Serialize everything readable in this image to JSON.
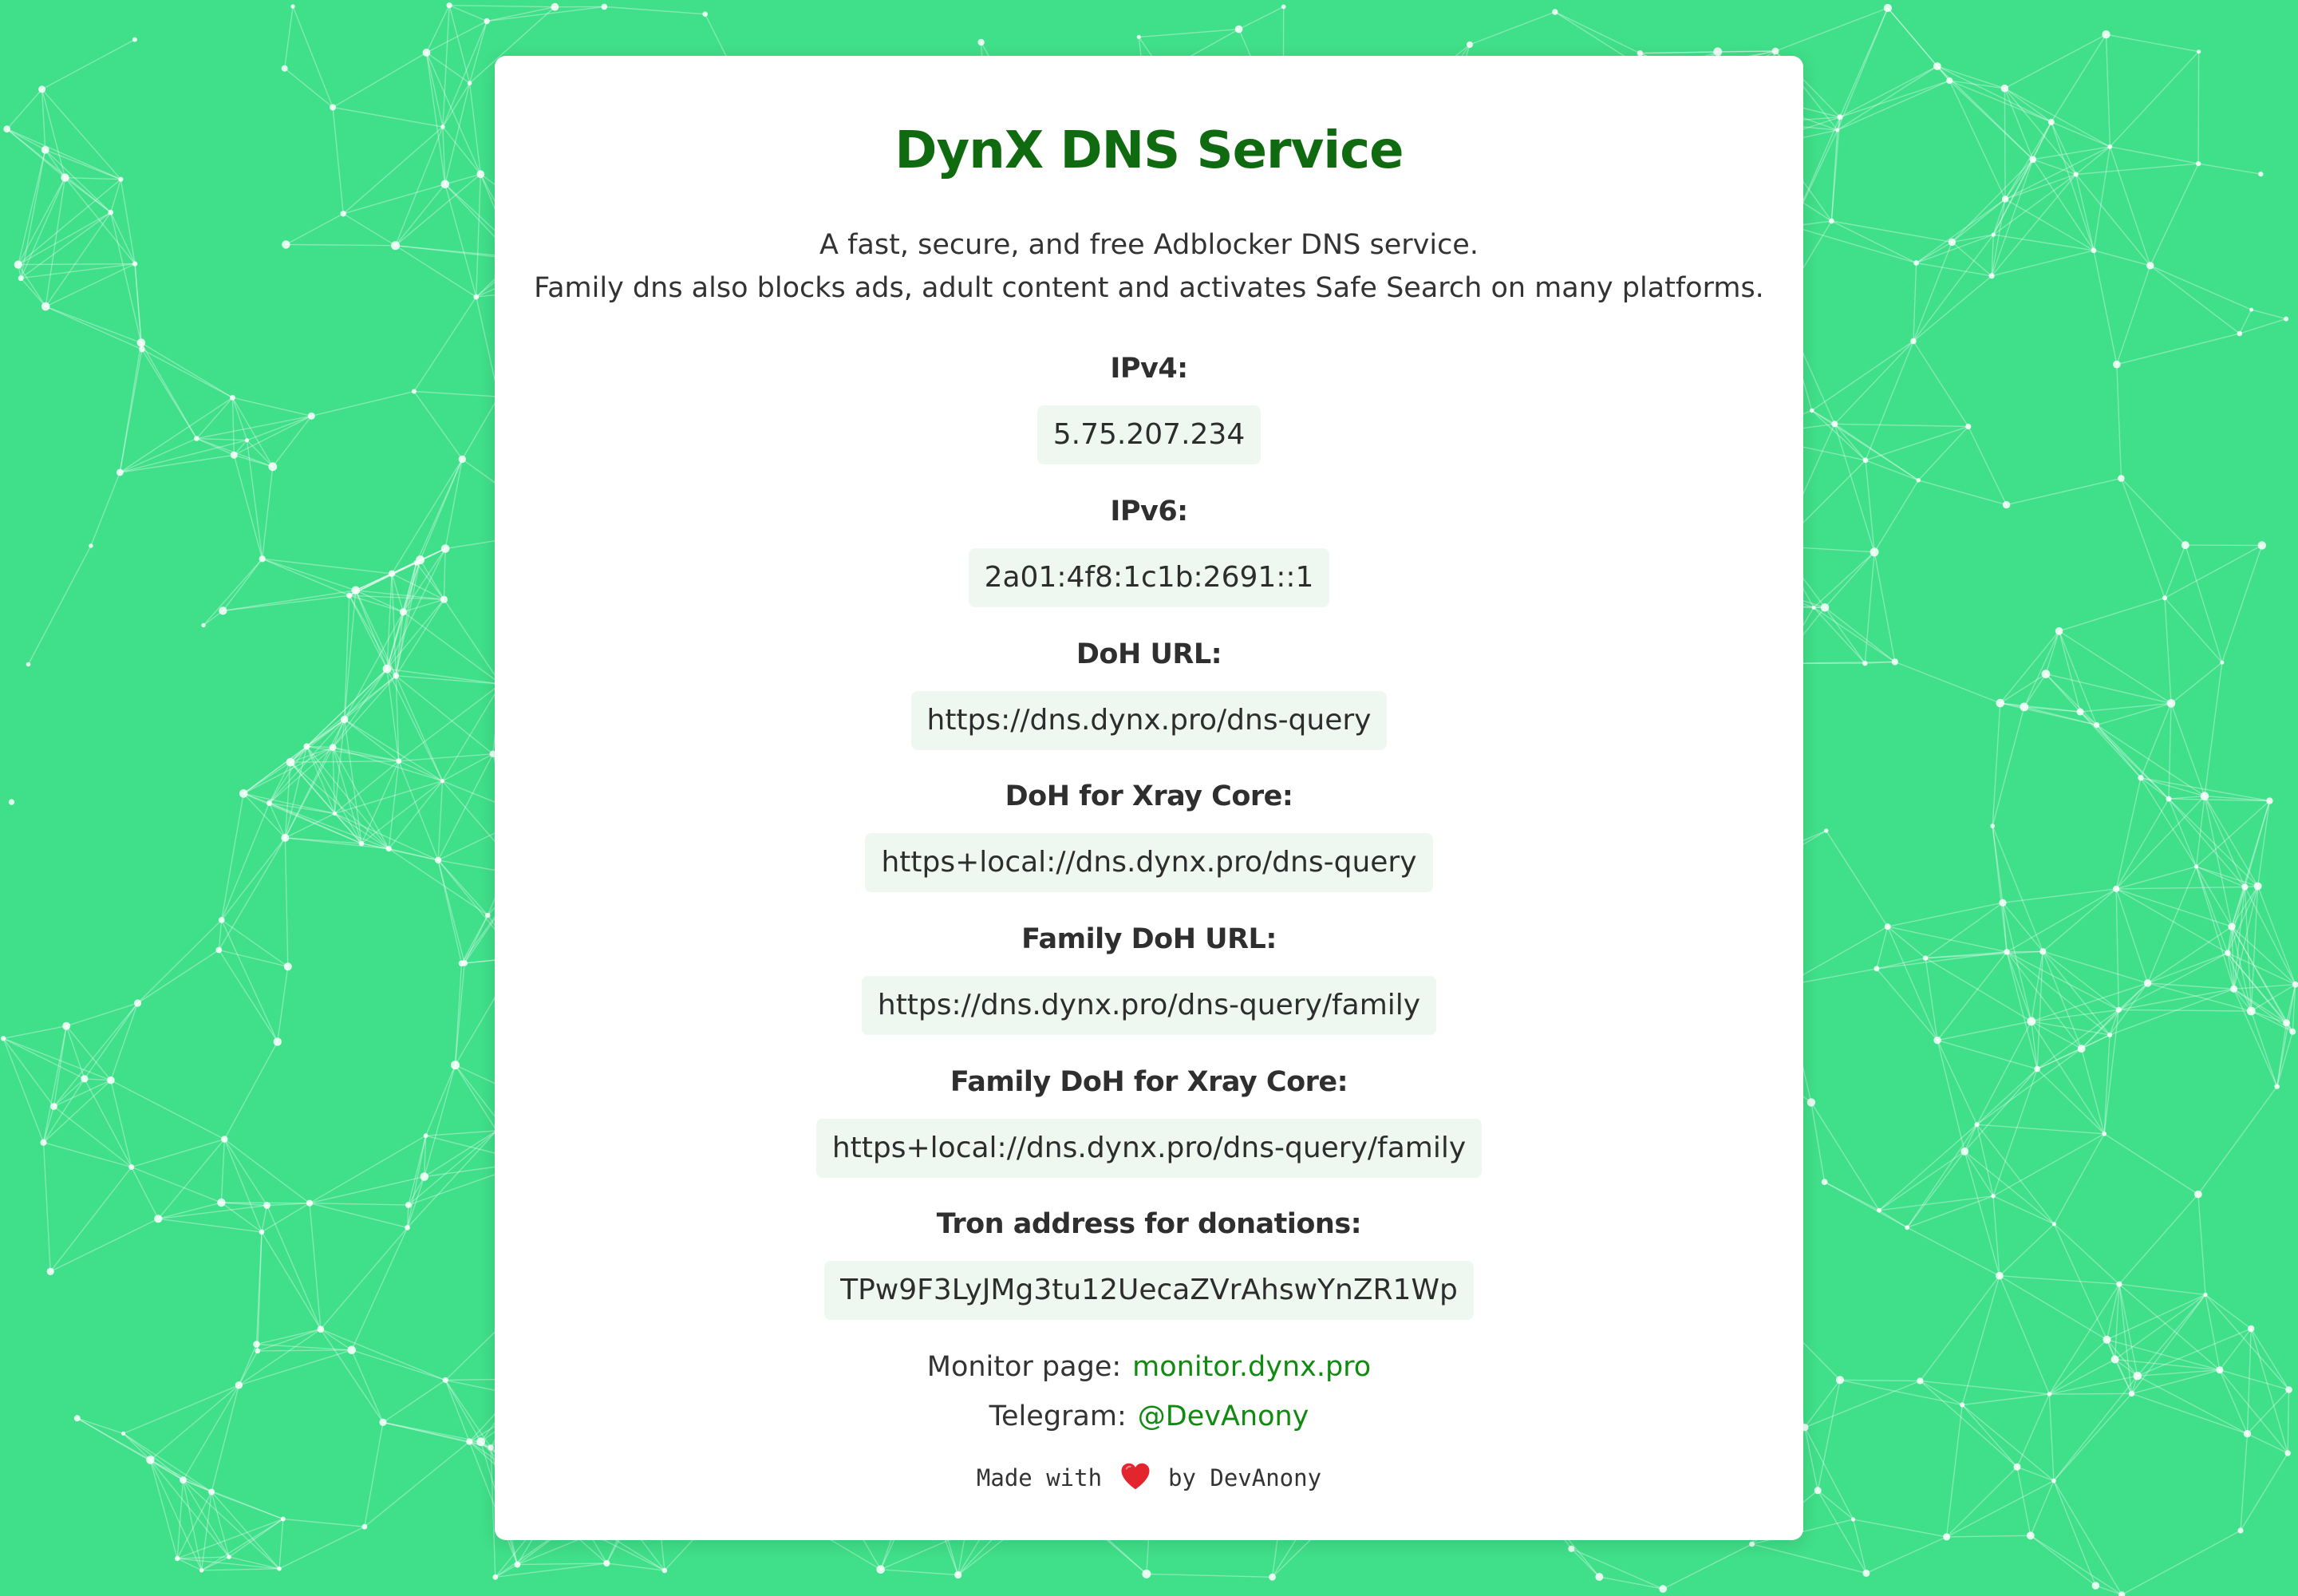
{
  "page": {
    "title": "DynX DNS Service",
    "description_line1": "A fast, secure, and free Adblocker DNS service.",
    "description_line2": "Family dns also blocks ads, adult content and activates Safe Search on many platforms."
  },
  "fields": [
    {
      "label": "IPv4:",
      "value": "5.75.207.234"
    },
    {
      "label": "IPv6:",
      "value": "2a01:4f8:1c1b:2691::1"
    },
    {
      "label": "DoH URL:",
      "value": "https://dns.dynx.pro/dns-query"
    },
    {
      "label": "DoH for Xray Core:",
      "value": "https+local://dns.dynx.pro/dns-query"
    },
    {
      "label": "Family DoH URL:",
      "value": "https://dns.dynx.pro/dns-query/family"
    },
    {
      "label": "Family DoH for Xray Core:",
      "value": "https+local://dns.dynx.pro/dns-query/family"
    },
    {
      "label": "Tron address for donations:",
      "value": "TPw9F3LyJMg3tu12UecaZVrAhswYnZR1Wp"
    }
  ],
  "links": {
    "monitor_label": "Monitor page:",
    "monitor_link": "monitor.dynx.pro",
    "telegram_label": "Telegram:",
    "telegram_link": "@DevAnony"
  },
  "footer": {
    "made_with": "Made with",
    "heart_icon": "heart-icon",
    "by": "by DevAnony"
  },
  "colors": {
    "background": "#40df89",
    "title": "#106b10",
    "link": "#118a11",
    "value_box": "#eef8f1",
    "heart": "#e3262e"
  }
}
